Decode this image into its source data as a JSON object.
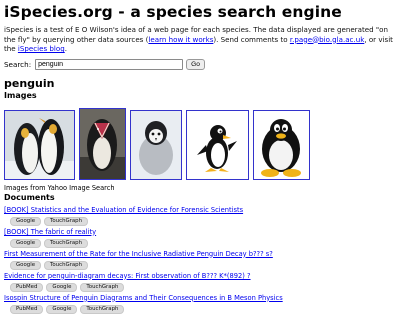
{
  "header": {
    "title": "iSpecies.org - a species search engine"
  },
  "intro": {
    "part1": "iSpecies is a test of E O Wilson's idea of a web page for each species. The data displayed are generated \"on the fly\" by querying other data sources (",
    "link_how": "learn how it works",
    "part2": "). Send comments to ",
    "link_email": "r.page@bio.gla.ac.uk",
    "part3": ", or visit the ",
    "link_blog": "iSpecies blog",
    "part4": "."
  },
  "search": {
    "label": "Search:",
    "value": "penguin",
    "go_label": "Go"
  },
  "species": {
    "name": "penguin"
  },
  "images": {
    "heading": "Images",
    "credit": "Images from Yahoo Image Search"
  },
  "documents": {
    "heading": "Documents",
    "items": [
      {
        "title": "[BOOK] Statistics and the Evaluation of Evidence for Forensic Scientists",
        "buttons": [
          "Google",
          "TouchGraph"
        ]
      },
      {
        "title": "[BOOK] The fabric of reality",
        "buttons": [
          "Google",
          "TouchGraph"
        ]
      },
      {
        "title": "First Measurement of the Rate for the Inclusive Radiative Penguin Decay b??? s?",
        "buttons": [
          "Google",
          "TouchGraph"
        ]
      },
      {
        "title": "Evidence for penguin-diagram decays: First observation of B??? K*(892) ?",
        "buttons": [
          "PubMed",
          "Google",
          "TouchGraph"
        ]
      },
      {
        "title": "Isospin Structure of Penguin Diagrams and Their Consequences in B Meson Physics",
        "buttons": [
          "PubMed",
          "Google",
          "TouchGraph"
        ]
      }
    ]
  },
  "colors": {
    "link": "#0000ee",
    "thumb_border": "#3333cc",
    "pill_bg": "#dcdcdc"
  }
}
